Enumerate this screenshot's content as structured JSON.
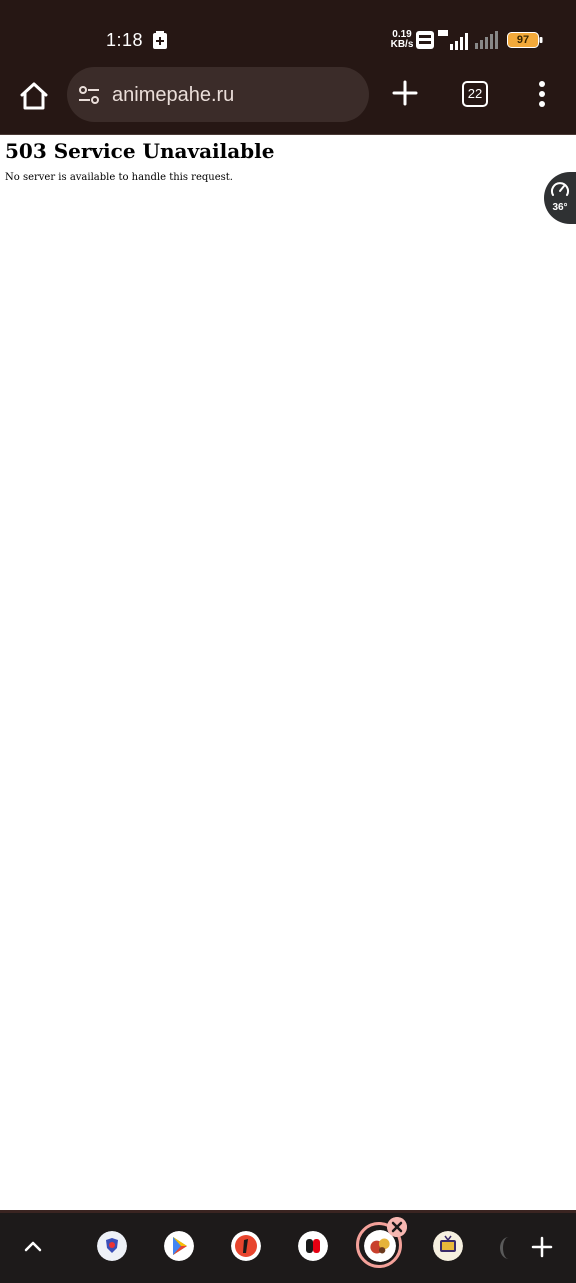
{
  "status_bar": {
    "time": "1:18",
    "net_speed_value": "0.19",
    "net_speed_unit": "KB/s",
    "battery_level": "97"
  },
  "browser": {
    "url": "animepahe.ru",
    "tab_count": "22"
  },
  "page": {
    "title": "503 Service Unavailable",
    "message": "No server is available to handle this request."
  },
  "widget": {
    "temperature": "36°"
  },
  "colors": {
    "toolbar_bg": "#261714",
    "url_bar_bg": "#3b2c29",
    "dock_bg": "#1d1a1a",
    "highlight_ring": "#f4a19a"
  },
  "dock": {
    "apps": [
      {
        "icon": "shield-app-icon"
      },
      {
        "icon": "play-store-icon"
      },
      {
        "icon": "red-one-app-icon"
      },
      {
        "icon": "switch-app-icon"
      },
      {
        "icon": "game-app-icon"
      },
      {
        "icon": "tv-app-icon"
      }
    ]
  }
}
